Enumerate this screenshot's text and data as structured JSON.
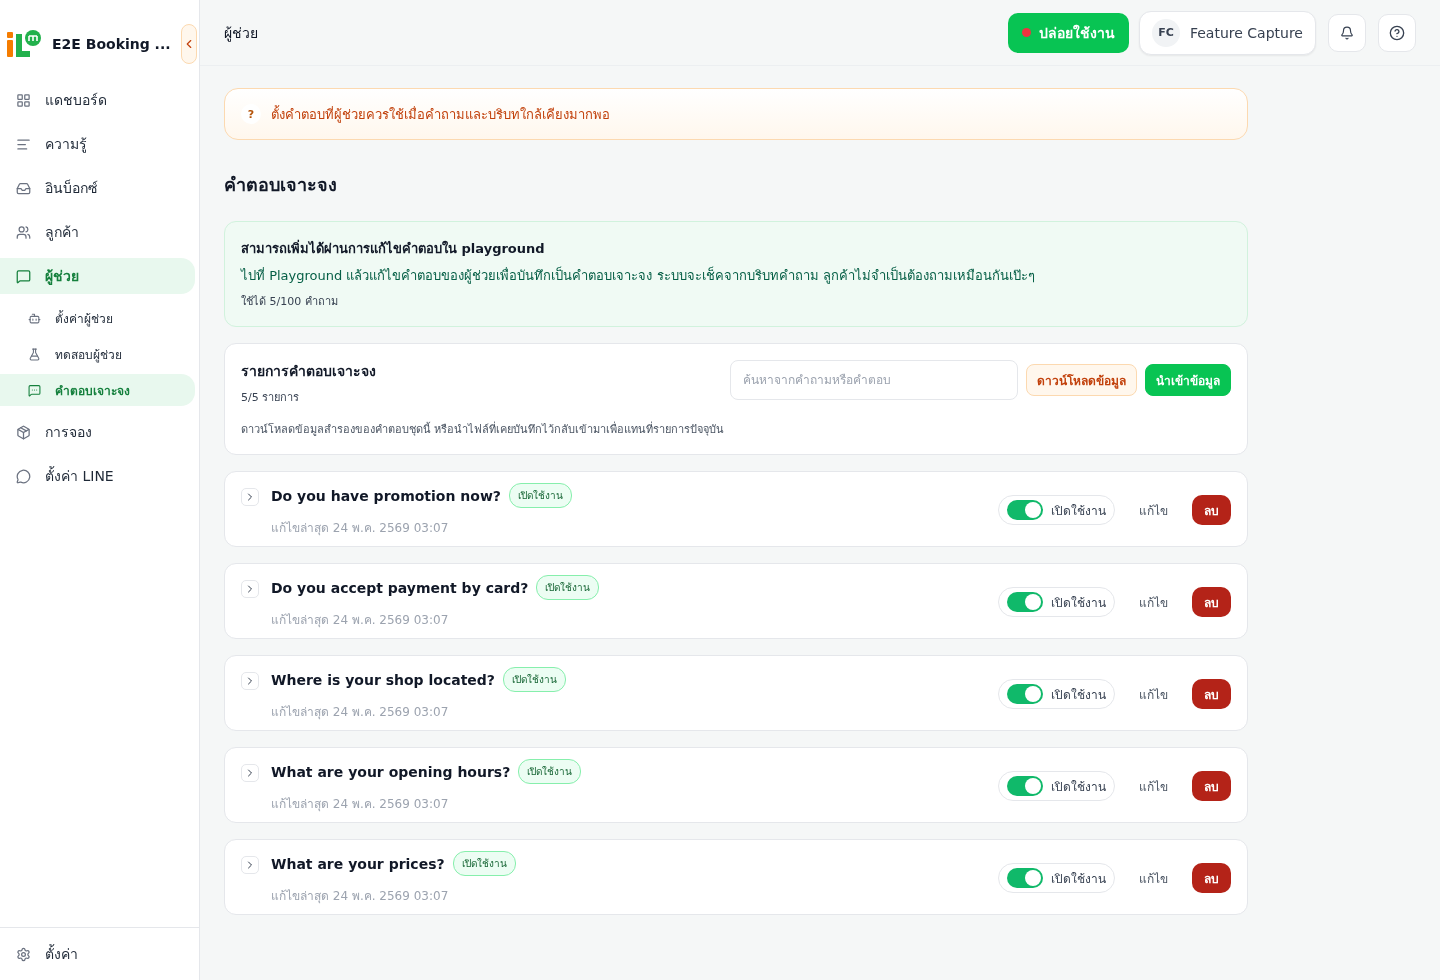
{
  "app": {
    "name": "E2E Booking ..."
  },
  "sidebar": {
    "items": [
      {
        "kind": "dashboard",
        "label": "แดชบอร์ด",
        "selected": false
      },
      {
        "kind": "knowledge",
        "label": "ความรู้",
        "selected": false
      },
      {
        "kind": "inbox",
        "label": "อินบ็อกซ์",
        "selected": false
      },
      {
        "kind": "customers",
        "label": "ลูกค้า",
        "selected": false
      },
      {
        "kind": "assistant",
        "label": "ผู้ช่วย",
        "selected": true,
        "children": [
          {
            "kind": "bot",
            "label": "ตั้งค่าผู้ช่วย",
            "selected": false
          },
          {
            "kind": "test",
            "label": "ทดสอบผู้ช่วย",
            "selected": false
          },
          {
            "kind": "answers",
            "label": "คำตอบเจาะจง",
            "selected": true
          }
        ]
      },
      {
        "kind": "booking",
        "label": "การจอง",
        "selected": false
      },
      {
        "kind": "line",
        "label": "ตั้งค่า LINE",
        "selected": false
      }
    ],
    "footer_item": {
      "kind": "settings",
      "label": "ตั้งค่า",
      "selected": false
    }
  },
  "header": {
    "title": "ผู้ช่วย",
    "release_button": "ปล่อยใช้งาน",
    "user": {
      "initials": "FC",
      "name": "Feature Capture"
    }
  },
  "notice": {
    "mark": "?",
    "text": "ตั้งคำตอบที่ผู้ช่วยควรใช้เมื่อคำถามและบริบทใกล้เคียงมากพอ"
  },
  "section_title": "คำตอบเจาะจง",
  "info": {
    "title": "สามารถเพิ่มได้ผ่านการแก้ไขคำตอบใน playground",
    "body": "ไปที่ Playground แล้วแก้ไขคำตอบของผู้ช่วยเพื่อบันทึกเป็นคำตอบเจาะจง ระบบจะเช็คจากบริบทคำถาม ลูกค้าไม่จำเป็นต้องถามเหมือนกันเป๊ะๆ",
    "usage": "ใช้ได้ 5/100 คำถาม"
  },
  "list_panel": {
    "title": "รายการคำตอบเจาะจง",
    "count": "5/5 รายการ",
    "search_placeholder": "ค้นหาจากคำถามหรือคำตอบ",
    "download_button": "ดาวน์โหลดข้อมูล",
    "import_button": "นำเข้าข้อมูล",
    "description": "ดาวน์โหลดข้อมูลสำรองของคำตอบชุดนี้ หรือนำไฟล์ที่เคยบันทึกไว้กลับเข้ามาเพื่อแทนที่รายการปัจจุบัน"
  },
  "answers": [
    {
      "question": "Do you have promotion now?",
      "badge": "เปิดใช้งาน",
      "edited": "แก้ไขล่าสุด 24 พ.ค. 2569 03:07",
      "on": true,
      "toggle_label": "เปิดใช้งาน",
      "edit_button": "แก้ไข",
      "delete_button": "ลบ"
    },
    {
      "question": "Do you accept payment by card?",
      "badge": "เปิดใช้งาน",
      "edited": "แก้ไขล่าสุด 24 พ.ค. 2569 03:07",
      "on": true,
      "toggle_label": "เปิดใช้งาน",
      "edit_button": "แก้ไข",
      "delete_button": "ลบ"
    },
    {
      "question": "Where is your shop located?",
      "badge": "เปิดใช้งาน",
      "edited": "แก้ไขล่าสุด 24 พ.ค. 2569 03:07",
      "on": true,
      "toggle_label": "เปิดใช้งาน",
      "edit_button": "แก้ไข",
      "delete_button": "ลบ"
    },
    {
      "question": "What are your opening hours?",
      "badge": "เปิดใช้งาน",
      "edited": "แก้ไขล่าสุด 24 พ.ค. 2569 03:07",
      "on": true,
      "toggle_label": "เปิดใช้งาน",
      "edit_button": "แก้ไข",
      "delete_button": "ลบ"
    },
    {
      "question": "What are your prices?",
      "badge": "เปิดใช้งาน",
      "edited": "แก้ไขล่าสุด 24 พ.ค. 2569 03:07",
      "on": true,
      "toggle_label": "เปิดใช้งาน",
      "edit_button": "แก้ไข",
      "delete_button": "ลบ"
    }
  ]
}
